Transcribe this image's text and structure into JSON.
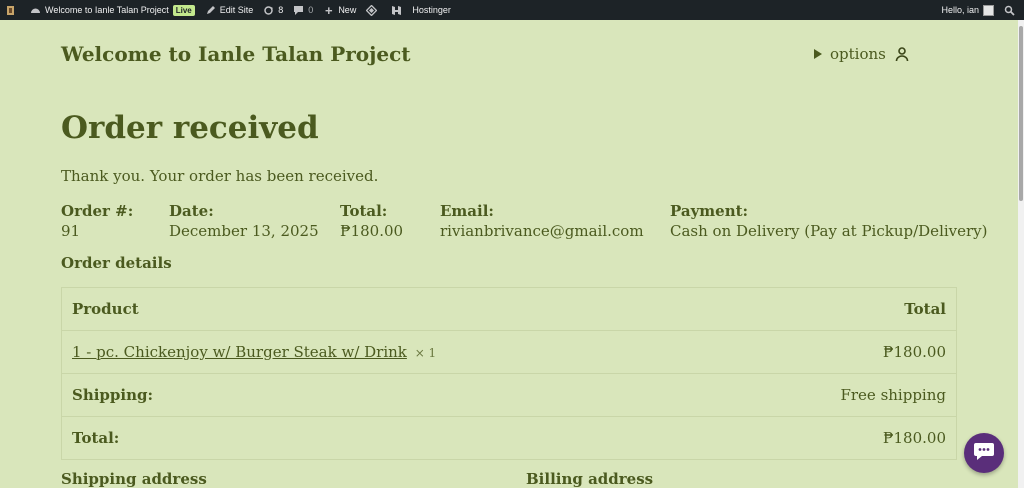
{
  "adminbar": {
    "site_name": "Welcome to Ianle Talan Project",
    "live_badge": "Live",
    "edit_site": "Edit Site",
    "updates_count": "8",
    "comments_count": "0",
    "new_label": "New",
    "hostinger_label": "Hostinger",
    "greeting": "Hello, ian"
  },
  "header": {
    "site_title": "Welcome to Ianle Talan Project",
    "options_label": "options"
  },
  "main": {
    "title": "Order received",
    "thanks": "Thank you. Your order has been received."
  },
  "overview": {
    "order_label": "Order #:",
    "order_value": "91",
    "date_label": "Date:",
    "date_value": "December 13, 2025",
    "total_label": "Total:",
    "total_value": "₱180.00",
    "email_label": "Email:",
    "email_value": "rivianbrivance@gmail.com",
    "payment_label": "Payment:",
    "payment_value": "Cash on Delivery (Pay at Pickup/Delivery)"
  },
  "details": {
    "heading": "Order details",
    "col_product": "Product",
    "col_total": "Total",
    "item_name": "1 - pc. Chickenjoy w/ Burger Steak w/ Drink",
    "item_qty": "× 1",
    "item_total": "₱180.00",
    "shipping_label": "Shipping:",
    "shipping_value": "Free shipping",
    "total_label": "Total:",
    "total_value": "₱180.00"
  },
  "addresses": {
    "shipping": "Shipping address",
    "billing": "Billing address"
  },
  "colors": {
    "background": "#d9e6bb",
    "text": "#4b5a1f",
    "adminbar": "#1d2327",
    "chat": "#5a2e7a"
  }
}
